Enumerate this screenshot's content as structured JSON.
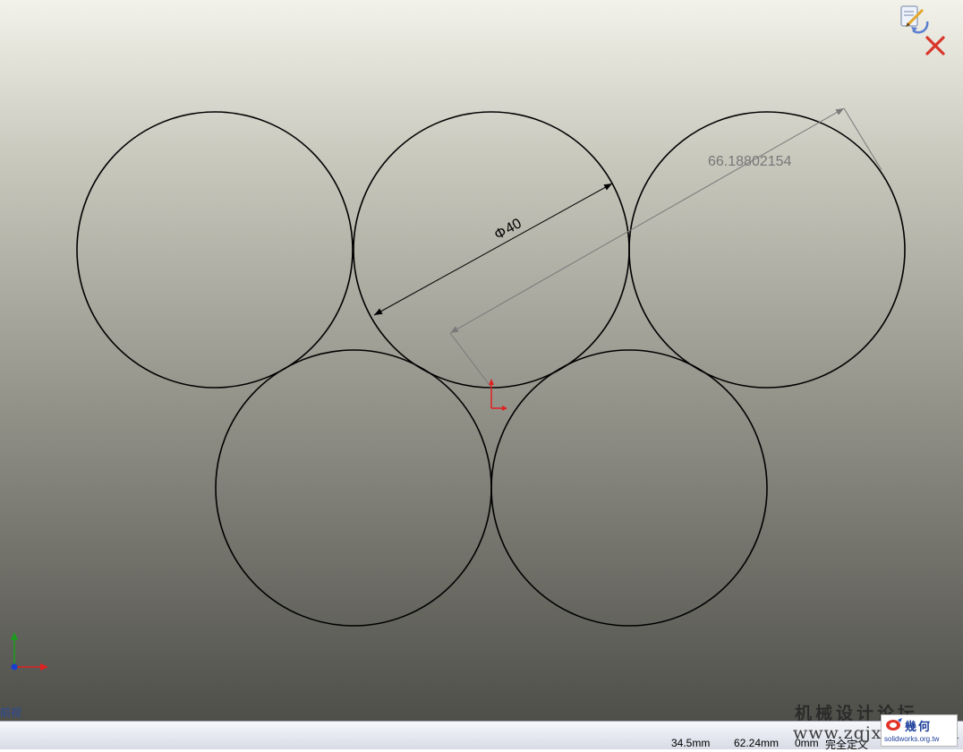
{
  "sketch": {
    "diameter_dimension": "40",
    "diameter_symbol": "Φ",
    "reference_dimension": "66.18802154"
  },
  "corner": {
    "confirm_icon": "sketch-confirm-corner-icon",
    "close_icon": "close-sketch-icon"
  },
  "view_label": "前视",
  "statusbar": {
    "x": "34.5mm",
    "y": "62.24mm",
    "z": "0mm",
    "state": "完全定义"
  },
  "watermark": {
    "title": "机械设计论坛",
    "url": "www.zgjxcad.com",
    "logo_text": "幾何",
    "logo_url": "solidworks.org.tw"
  },
  "colors": {
    "origin_red": "#e02020",
    "axis_green": "#1c9a1c",
    "axis_blue": "#1a3fd0",
    "close_red": "#d9362b",
    "view_label": "#2a4a9a"
  }
}
